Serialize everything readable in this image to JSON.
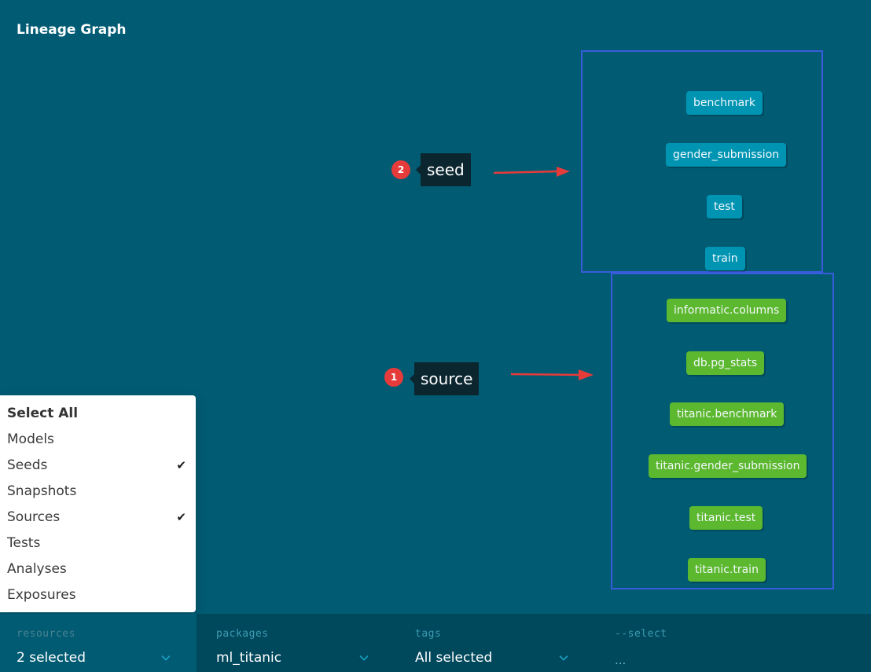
{
  "header": {
    "title": "Lineage Graph"
  },
  "seed_nodes": [
    "benchmark",
    "gender_submission",
    "test",
    "train"
  ],
  "source_nodes": [
    "informatic.columns",
    "db.pg_stats",
    "titanic.benchmark",
    "titanic.gender_submission",
    "titanic.test",
    "titanic.train"
  ],
  "callouts": [
    {
      "number": "2",
      "label": "seed"
    },
    {
      "number": "1",
      "label": "source"
    }
  ],
  "resource_menu": {
    "items": [
      {
        "label": "Select All",
        "checked": false
      },
      {
        "label": "Models",
        "checked": false
      },
      {
        "label": "Seeds",
        "checked": true
      },
      {
        "label": "Snapshots",
        "checked": false
      },
      {
        "label": "Sources",
        "checked": true
      },
      {
        "label": "Tests",
        "checked": false
      },
      {
        "label": "Analyses",
        "checked": false
      },
      {
        "label": "Exposures",
        "checked": false
      }
    ],
    "check_glyph": "✔"
  },
  "filters": {
    "resources": {
      "label": "resources",
      "value": "2 selected"
    },
    "packages": {
      "label": "packages",
      "value": "ml_titanic"
    },
    "tags": {
      "label": "tags",
      "value": "All selected"
    },
    "select": {
      "label": "--select",
      "value": "..."
    }
  },
  "colors": {
    "background": "#005b73",
    "seed_node": "#0094b3",
    "source_node": "#5cb82e",
    "highlight_box": "#3a5cdb",
    "annotation_red": "#e53b3b"
  }
}
